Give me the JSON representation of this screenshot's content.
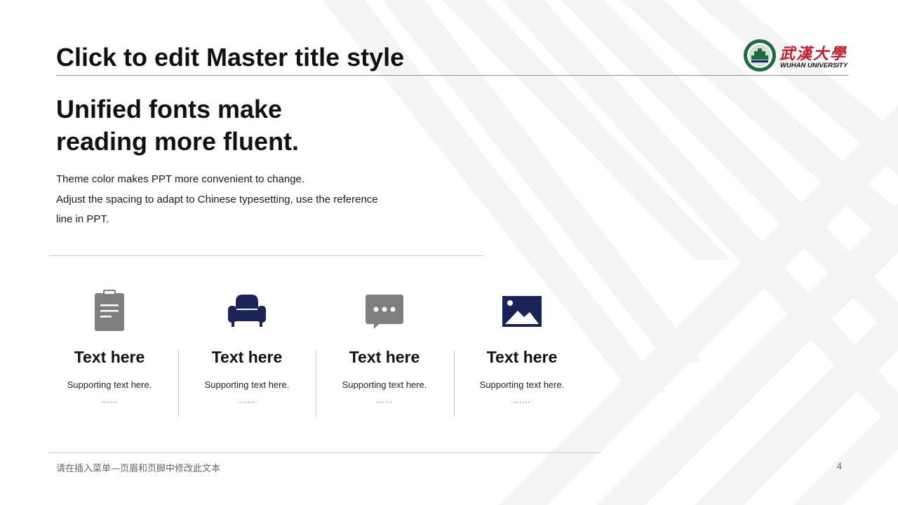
{
  "slide": {
    "master_title": "Click to edit Master title style",
    "headline_lines": [
      "Unified fonts make",
      "reading more fluent."
    ],
    "body_lines": [
      "Theme color makes PPT more convenient to change.",
      "Adjust the spacing to adapt to Chinese typesetting, use the reference",
      "line in PPT."
    ],
    "logo": {
      "cn": "武漢大學",
      "en": "WUHAN UNIVERSITY"
    },
    "cards": [
      {
        "icon": "clipboard-icon",
        "icon_color": "#7f7f7f",
        "title": "Text here",
        "subtitle": "Supporting text here.",
        "ellipsis": "……"
      },
      {
        "icon": "sofa-icon",
        "icon_color": "#1a2458",
        "title": "Text here",
        "subtitle": "Supporting text here.",
        "ellipsis": "……"
      },
      {
        "icon": "chat-bubble-icon",
        "icon_color": "#7f7f7f",
        "title": "Text here",
        "subtitle": "Supporting text here.",
        "ellipsis": "……"
      },
      {
        "icon": "image-icon",
        "icon_color": "#1a2458",
        "title": "Text here",
        "subtitle": "Supporting text here.",
        "ellipsis": "……"
      }
    ],
    "footer_text": "请在插入菜单—页眉和页脚中修改此文本",
    "page_number": "4"
  },
  "colors": {
    "accent_navy": "#1a2458",
    "icon_gray": "#7f7f7f",
    "logo_red": "#c0202a",
    "logo_green": "#1e6b3c",
    "stripe_gray": "#f4f4f4"
  }
}
